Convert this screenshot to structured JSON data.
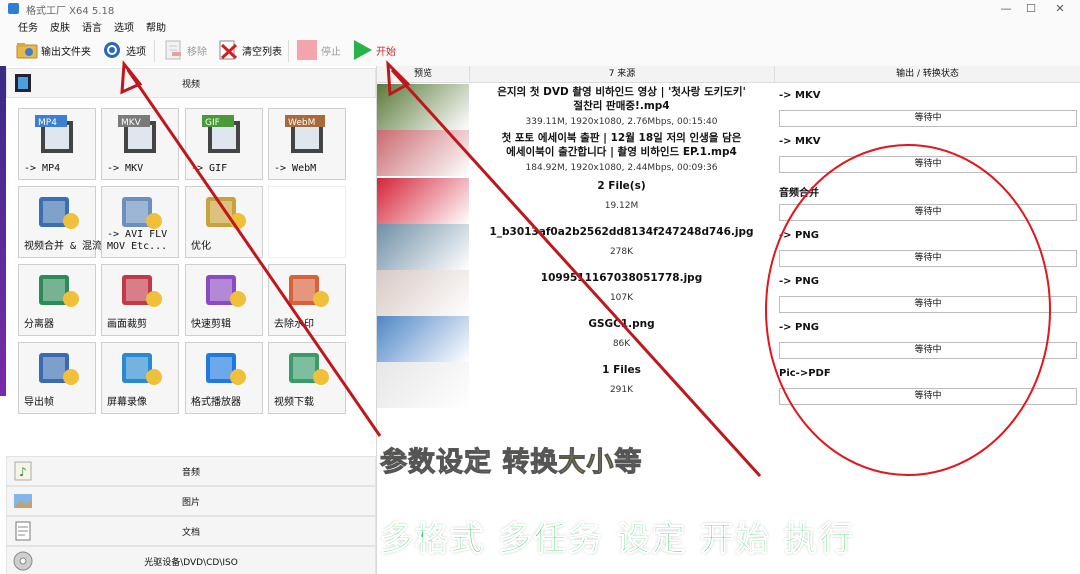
{
  "window": {
    "title": "格式工厂 X64 5.18",
    "controls": [
      "—",
      "☐",
      "✕"
    ]
  },
  "menu": [
    "任务",
    "皮肤",
    "语言",
    "选项",
    "帮助"
  ],
  "toolbar": {
    "output_folder": "输出文件夹",
    "options": "选项",
    "remove": "移除",
    "clear_list": "清空列表",
    "stop": "停止",
    "start": "开始"
  },
  "left": {
    "video_header": "视频",
    "tiles": [
      {
        "badge": "MP4",
        "label": "-> MP4",
        "icon": "mp4-film-icon"
      },
      {
        "badge": "MKV",
        "label": "-> MKV",
        "icon": "mkv-film-icon"
      },
      {
        "badge": "GIF",
        "label": "-> GIF",
        "icon": "gif-image-icon"
      },
      {
        "badge": "WebM",
        "label": "-> WebM",
        "icon": "webm-film-icon"
      },
      {
        "badge": "",
        "label": "视频合并 & 混流",
        "icon": "video-merge-icon"
      },
      {
        "badge": "",
        "label": "-> AVI FLV\nMOV Etc...",
        "icon": "convert-formats-icon"
      },
      {
        "badge": "",
        "label": "优化",
        "icon": "optimize-gear-icon"
      },
      {
        "badge": "",
        "label": "",
        "icon": "blank"
      },
      {
        "badge": "",
        "label": "分离器",
        "icon": "splitter-icon"
      },
      {
        "badge": "",
        "label": "画面裁剪",
        "icon": "crop-scissors-icon"
      },
      {
        "badge": "",
        "label": "快速剪辑",
        "icon": "quick-cut-icon"
      },
      {
        "badge": "",
        "label": "去除水印",
        "icon": "remove-watermark-icon"
      },
      {
        "badge": "",
        "label": "导出帧",
        "icon": "export-frame-icon"
      },
      {
        "badge": "",
        "label": "屏幕录像",
        "icon": "screen-record-icon"
      },
      {
        "badge": "",
        "label": "格式播放器",
        "icon": "player-icon"
      },
      {
        "badge": "",
        "label": "视频下载",
        "icon": "video-download-icon"
      }
    ],
    "categories": [
      "音频",
      "图片",
      "文档",
      "光驱设备\\DVD\\CD\\ISO"
    ]
  },
  "grid": {
    "columns": [
      "预览",
      "7 来源",
      "输出 / 转换状态"
    ],
    "rows": [
      {
        "name": "은지의 첫 DVD 촬영 비하인드 영상 | '첫사랑 도키도키'\n절찬리 판매중!.mp4",
        "info": "339.11M, 1920x1080, 2.76Mbps, 00:15:40",
        "output": "-> MKV",
        "status": "等待中",
        "thumb": "#5a7a3a"
      },
      {
        "name": "첫 포토 에세이북 출판 | 12월 18일 저의 인생을 담은\n에세이북이 출간합니다 | 촬영 비하인드 EP.1.mp4",
        "info": "184.92M, 1920x1080, 2.44Mbps, 00:09:36",
        "output": "-> MKV",
        "status": "等待中",
        "thumb": "#c96a6f"
      },
      {
        "name": "2 File(s)",
        "info": "19.12M",
        "output": "音频合并",
        "status": "等待中",
        "thumb": "#d4243a"
      },
      {
        "name": "1_b3013af0a2b2562dd8134f247248d746.jpg",
        "info": "278K",
        "output": "-> PNG",
        "status": "等待中",
        "thumb": "#6f8fa6"
      },
      {
        "name": "1099511167038051778.jpg",
        "info": "107K",
        "output": "-> PNG",
        "status": "等待中",
        "thumb": "#d8c9c4"
      },
      {
        "name": "GSGC1.png",
        "info": "86K",
        "output": "-> PNG",
        "status": "等待中",
        "thumb": "#4f86c6"
      },
      {
        "name": "1 Files",
        "info": "291K",
        "output": "Pic->PDF",
        "status": "等待中",
        "thumb": "#e6e6e6"
      }
    ]
  },
  "annotations": {
    "text1": "参数设定 转换大小等",
    "text2": "多格式 多任务 设定  开始 执行",
    "colors": {
      "arrow": "#c0171c",
      "ellipse": "#e3161e",
      "text1": "#ffe600",
      "text2": "#22d35a"
    }
  }
}
